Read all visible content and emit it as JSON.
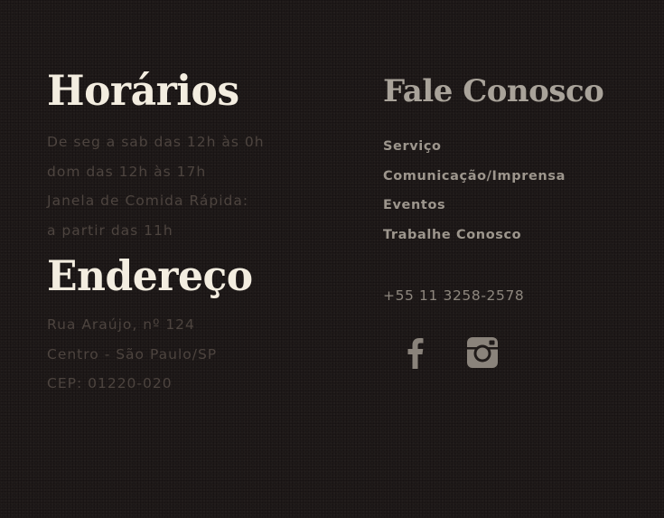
{
  "hours": {
    "title": "Horários",
    "lines": [
      "De seg a sab das 12h às 0h",
      "dom das 12h às 17h",
      "Janela de Comida Rápida:",
      "a partir das 11h"
    ]
  },
  "address": {
    "title": "Endereço",
    "lines": [
      "Rua Araújo, nº 124",
      "Centro - São Paulo/SP",
      "CEP: 01220-020"
    ]
  },
  "contact": {
    "title": "Fale Conosco",
    "links": [
      "Serviço",
      "Comunicação/Imprensa",
      "Eventos",
      "Trabalhe Conosco"
    ],
    "phone": "+55 11 3258-2578",
    "social_icons": [
      "facebook-icon",
      "instagram-icon"
    ],
    "icon_color": "#8a837b"
  },
  "colors": {
    "background": "#1f1a19",
    "heading": "#f3ede0",
    "muted_text": "#4d443f",
    "link_text": "#9d968d"
  }
}
